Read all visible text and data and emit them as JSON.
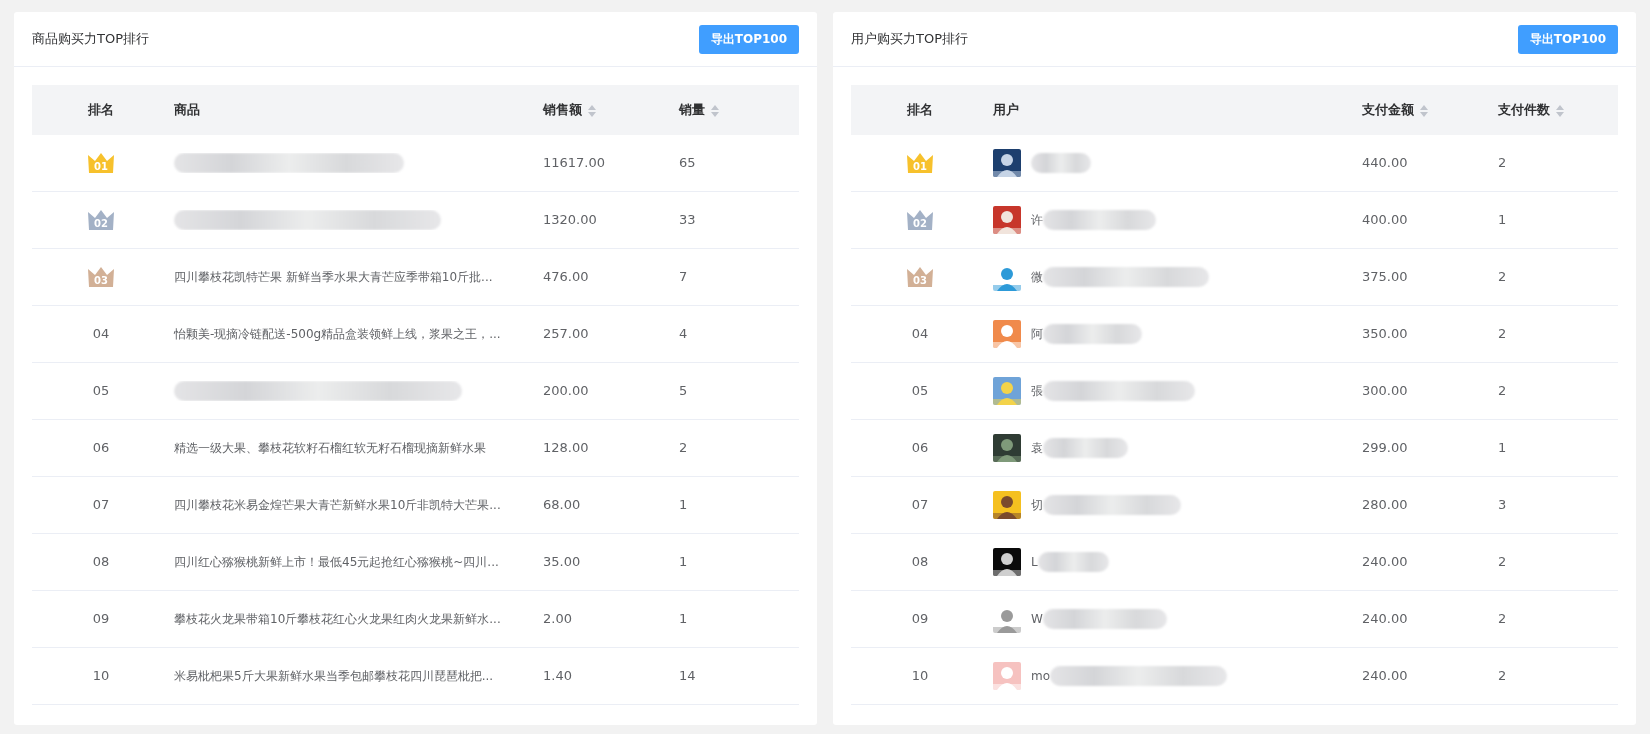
{
  "panels": [
    {
      "title": "商品购买力TOP排行",
      "export_button": "导出TOP100",
      "kind": "product",
      "columns": [
        {
          "label": "排名",
          "sortable": false
        },
        {
          "label": "商品",
          "sortable": false
        },
        {
          "label": "销售额",
          "sortable": true
        },
        {
          "label": "销量",
          "sortable": true
        }
      ],
      "rows": [
        {
          "rank": "01",
          "kind": "crown",
          "color": "#f7c12c",
          "item": {
            "redacted": true
          },
          "amount": "11617.00",
          "count": "65"
        },
        {
          "rank": "02",
          "kind": "crown",
          "color": "#a3b1c6",
          "item": {
            "redacted": true
          },
          "amount": "1320.00",
          "count": "33"
        },
        {
          "rank": "03",
          "kind": "crown",
          "color": "#d2b096",
          "item": {
            "text": "四川攀枝花凯特芒果 新鲜当季水果大青芒应季带箱10斤批...",
            "redacted": false
          },
          "amount": "476.00",
          "count": "7"
        },
        {
          "rank": "04",
          "kind": "plain",
          "item": {
            "text": "怡颗美-现摘冷链配送-500g精品盒装领鲜上线，浆果之王，...",
            "redacted": false
          },
          "amount": "257.00",
          "count": "4"
        },
        {
          "rank": "05",
          "kind": "plain",
          "item": {
            "redacted": true
          },
          "amount": "200.00",
          "count": "5"
        },
        {
          "rank": "06",
          "kind": "plain",
          "item": {
            "text": "精选一级大果、攀枝花软籽石榴红软无籽石榴现摘新鲜水果",
            "redacted": false
          },
          "amount": "128.00",
          "count": "2"
        },
        {
          "rank": "07",
          "kind": "plain",
          "item": {
            "text": "四川攀枝花米易金煌芒果大青芒新鲜水果10斤非凯特大芒果...",
            "redacted": false
          },
          "amount": "68.00",
          "count": "1"
        },
        {
          "rank": "08",
          "kind": "plain",
          "item": {
            "text": "四川红心猕猴桃新鲜上市！最低45元起抢红心猕猴桃~四川...",
            "redacted": false
          },
          "amount": "35.00",
          "count": "1"
        },
        {
          "rank": "09",
          "kind": "plain",
          "item": {
            "text": "攀枝花火龙果带箱10斤攀枝花红心火龙果红肉火龙果新鲜水...",
            "redacted": false
          },
          "amount": "2.00",
          "count": "1"
        },
        {
          "rank": "10",
          "kind": "plain",
          "item": {
            "text": "米易枇杷果5斤大果新鲜水果当季包邮攀枝花四川琵琶枇把...",
            "redacted": false
          },
          "amount": "1.40",
          "count": "14"
        }
      ]
    },
    {
      "title": "用户购买力TOP排行",
      "export_button": "导出TOP100",
      "kind": "user",
      "columns": [
        {
          "label": "排名",
          "sortable": false
        },
        {
          "label": "用户",
          "sortable": false
        },
        {
          "label": "支付金额",
          "sortable": true
        },
        {
          "label": "支付件数",
          "sortable": true
        }
      ],
      "rows": [
        {
          "rank": "01",
          "kind": "crown",
          "color": "#f7c12c",
          "item": {
            "redacted": true
          },
          "amount": "440.00",
          "count": "2"
        },
        {
          "rank": "02",
          "kind": "crown",
          "color": "#a3b1c6",
          "item": {
            "text": "许",
            "redacted": true
          },
          "amount": "400.00",
          "count": "1"
        },
        {
          "rank": "03",
          "kind": "crown",
          "color": "#d2b096",
          "item": {
            "text": "微",
            "redacted": true
          },
          "amount": "375.00",
          "count": "2"
        },
        {
          "rank": "04",
          "kind": "plain",
          "item": {
            "text": "阿",
            "redacted": true
          },
          "amount": "350.00",
          "count": "2"
        },
        {
          "rank": "05",
          "kind": "plain",
          "item": {
            "text": "張",
            "redacted": true
          },
          "amount": "300.00",
          "count": "2"
        },
        {
          "rank": "06",
          "kind": "plain",
          "item": {
            "text": "袁",
            "redacted": true
          },
          "amount": "299.00",
          "count": "1"
        },
        {
          "rank": "07",
          "kind": "plain",
          "item": {
            "text": "切",
            "redacted": true
          },
          "amount": "280.00",
          "count": "3"
        },
        {
          "rank": "08",
          "kind": "plain",
          "item": {
            "text": "L",
            "redacted": true
          },
          "amount": "240.00",
          "count": "2"
        },
        {
          "rank": "09",
          "kind": "plain",
          "item": {
            "text": "W",
            "redacted": true
          },
          "amount": "240.00",
          "count": "2"
        },
        {
          "rank": "10",
          "kind": "plain",
          "item": {
            "text": "mo",
            "redacted": true
          },
          "amount": "240.00",
          "count": "2"
        }
      ]
    }
  ]
}
